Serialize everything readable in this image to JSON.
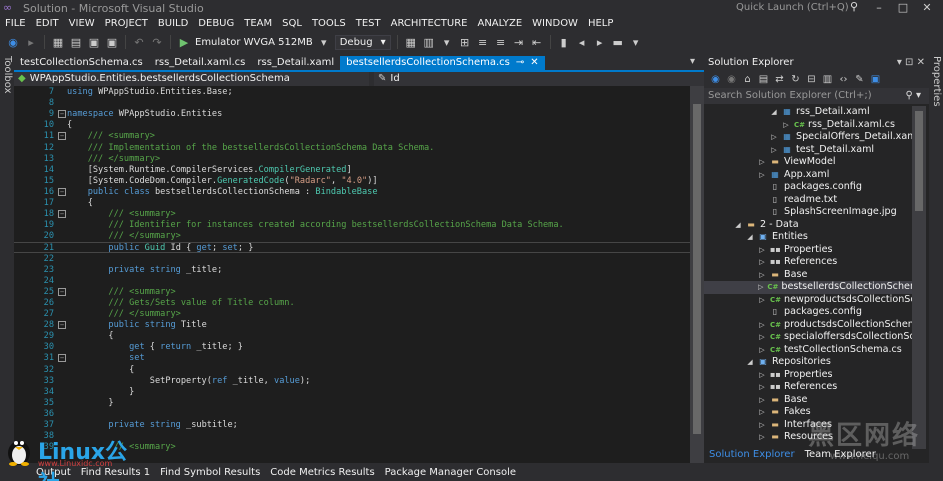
{
  "window": {
    "title": "Solution - Microsoft Visual Studio",
    "quick_launch": "Quick Launch (Ctrl+Q)"
  },
  "menu": [
    "FILE",
    "EDIT",
    "VIEW",
    "PROJECT",
    "BUILD",
    "DEBUG",
    "TEAM",
    "SQL",
    "TOOLS",
    "TEST",
    "ARCHITECTURE",
    "ANALYZE",
    "WINDOW",
    "HELP"
  ],
  "toolbar": {
    "run_target": "Emulator WVGA 512MB",
    "configuration": "Debug"
  },
  "side_tabs": {
    "left": "Toolbox",
    "right": "Properties"
  },
  "doc_tabs": [
    {
      "label": "testCollectionSchema.cs",
      "active": false
    },
    {
      "label": "rss_Detail.xaml.cs",
      "active": false
    },
    {
      "label": "rss_Detail.xaml",
      "active": false
    },
    {
      "label": "bestsellerdsCollectionSchema.cs",
      "active": true
    }
  ],
  "navbar": {
    "type_scope": "WPAppStudio.Entities.bestsellerdsCollectionSchema",
    "member_scope": "Id"
  },
  "editor": {
    "lines": [
      {
        "n": "7",
        "code": "using WPAppStudio.Entities.Base;"
      },
      {
        "n": "8",
        "code": ""
      },
      {
        "n": "9",
        "code": "namespace WPAppStudio.Entities"
      },
      {
        "n": "10",
        "code": "{"
      },
      {
        "n": "11",
        "code": "    /// <summary>"
      },
      {
        "n": "12",
        "code": "    /// Implementation of the bestsellerdsCollectionSchema Data Schema."
      },
      {
        "n": "13",
        "code": "    /// </summary>"
      },
      {
        "n": "14",
        "code": "    [System.Runtime.CompilerServices.CompilerGenerated]"
      },
      {
        "n": "15",
        "code": "    [System.CodeDom.Compiler.GeneratedCode(\"Radarc\", \"4.0\")]"
      },
      {
        "n": "16",
        "code": "    public class bestsellerdsCollectionSchema : BindableBase"
      },
      {
        "n": "17",
        "code": "    {"
      },
      {
        "n": "18",
        "code": "        /// <summary>"
      },
      {
        "n": "19",
        "code": "        /// Identifier for instances created according bestsellerdsCollectionSchema Data Schema."
      },
      {
        "n": "20",
        "code": "        /// </summary>"
      },
      {
        "n": "21",
        "code": "        public Guid Id { get; set; }"
      },
      {
        "n": "22",
        "code": ""
      },
      {
        "n": "23",
        "code": "        private string _title;"
      },
      {
        "n": "24",
        "code": ""
      },
      {
        "n": "25",
        "code": "        /// <summary>"
      },
      {
        "n": "26",
        "code": "        /// Gets/Sets value of Title column."
      },
      {
        "n": "27",
        "code": "        /// </summary>"
      },
      {
        "n": "28",
        "code": "        public string Title"
      },
      {
        "n": "29",
        "code": "        {"
      },
      {
        "n": "30",
        "code": "            get { return _title; }"
      },
      {
        "n": "31",
        "code": "            set"
      },
      {
        "n": "32",
        "code": "            {"
      },
      {
        "n": "33",
        "code": "                SetProperty(ref _title, value);"
      },
      {
        "n": "34",
        "code": "            }"
      },
      {
        "n": "35",
        "code": "        }"
      },
      {
        "n": "36",
        "code": ""
      },
      {
        "n": "37",
        "code": "        private string _subtitle;"
      },
      {
        "n": "38",
        "code": ""
      },
      {
        "n": "39",
        "code": "        /// <summary>"
      }
    ]
  },
  "bottom_tabs": [
    "Output",
    "Find Results 1",
    "Find Symbol Results",
    "Code Metrics Results",
    "Package Manager Console"
  ],
  "solution_explorer": {
    "title": "Solution Explorer",
    "search_placeholder": "Search Solution Explorer (Ctrl+;)",
    "items": [
      {
        "label": "rss_Detail.xaml",
        "icon": "xaml",
        "depth": 3,
        "expander": "open"
      },
      {
        "label": "rss_Detail.xaml.cs",
        "icon": "cs",
        "depth": 4,
        "expander": "closed"
      },
      {
        "label": "SpecialOffers_Detail.xaml",
        "icon": "xaml",
        "depth": 3,
        "expander": "closed"
      },
      {
        "label": "test_Detail.xaml",
        "icon": "xaml",
        "depth": 3,
        "expander": "closed"
      },
      {
        "label": "ViewModel",
        "icon": "folder",
        "depth": 2,
        "expander": "closed"
      },
      {
        "label": "App.xaml",
        "icon": "xaml",
        "depth": 2,
        "expander": "closed"
      },
      {
        "label": "packages.config",
        "icon": "file",
        "depth": 2,
        "expander": "none"
      },
      {
        "label": "readme.txt",
        "icon": "file",
        "depth": 2,
        "expander": "none"
      },
      {
        "label": "SplashScreenImage.jpg",
        "icon": "file",
        "depth": 2,
        "expander": "none"
      },
      {
        "label": "2 - Data",
        "icon": "folder",
        "depth": 0,
        "expander": "open"
      },
      {
        "label": "Entities",
        "icon": "proj",
        "depth": 1,
        "expander": "open"
      },
      {
        "label": "Properties",
        "icon": "ref",
        "depth": 2,
        "expander": "closed"
      },
      {
        "label": "References",
        "icon": "ref",
        "depth": 2,
        "expander": "closed"
      },
      {
        "label": "Base",
        "icon": "folder",
        "depth": 2,
        "expander": "closed"
      },
      {
        "label": "bestsellerdsCollectionSchema.cs",
        "icon": "cs",
        "depth": 2,
        "expander": "closed",
        "selected": true
      },
      {
        "label": "newproductsdsCollectionSchema.cs",
        "icon": "cs",
        "depth": 2,
        "expander": "closed"
      },
      {
        "label": "packages.config",
        "icon": "file",
        "depth": 2,
        "expander": "none"
      },
      {
        "label": "productsdsCollectionSchema.cs",
        "icon": "cs",
        "depth": 2,
        "expander": "closed"
      },
      {
        "label": "specialoffersdsCollectionSchema.cs",
        "icon": "cs",
        "depth": 2,
        "expander": "closed"
      },
      {
        "label": "testCollectionSchema.cs",
        "icon": "cs",
        "depth": 2,
        "expander": "closed"
      },
      {
        "label": "Repositories",
        "icon": "proj",
        "depth": 1,
        "expander": "open"
      },
      {
        "label": "Properties",
        "icon": "ref",
        "depth": 2,
        "expander": "closed"
      },
      {
        "label": "References",
        "icon": "ref",
        "depth": 2,
        "expander": "closed"
      },
      {
        "label": "Base",
        "icon": "folder",
        "depth": 2,
        "expander": "closed"
      },
      {
        "label": "Fakes",
        "icon": "folder",
        "depth": 2,
        "expander": "closed"
      },
      {
        "label": "Interfaces",
        "icon": "folder",
        "depth": 2,
        "expander": "closed"
      },
      {
        "label": "Resources",
        "icon": "folder",
        "depth": 2,
        "expander": "closed"
      }
    ],
    "tabs": [
      "Solution Explorer",
      "Team Explorer"
    ]
  },
  "watermarks": {
    "linux_name": "Linux公社",
    "linux_sub": "www.Linuxidc.com",
    "heiqu_big": "黑区网络",
    "heiqu_small": "www.heiqu.com"
  },
  "colors": {
    "accent": "#007acc",
    "editor_bg": "#1e1e1e",
    "keyword": "#569cd6",
    "comment": "#57a64a",
    "type": "#4ec9b0",
    "string": "#d69d85"
  }
}
